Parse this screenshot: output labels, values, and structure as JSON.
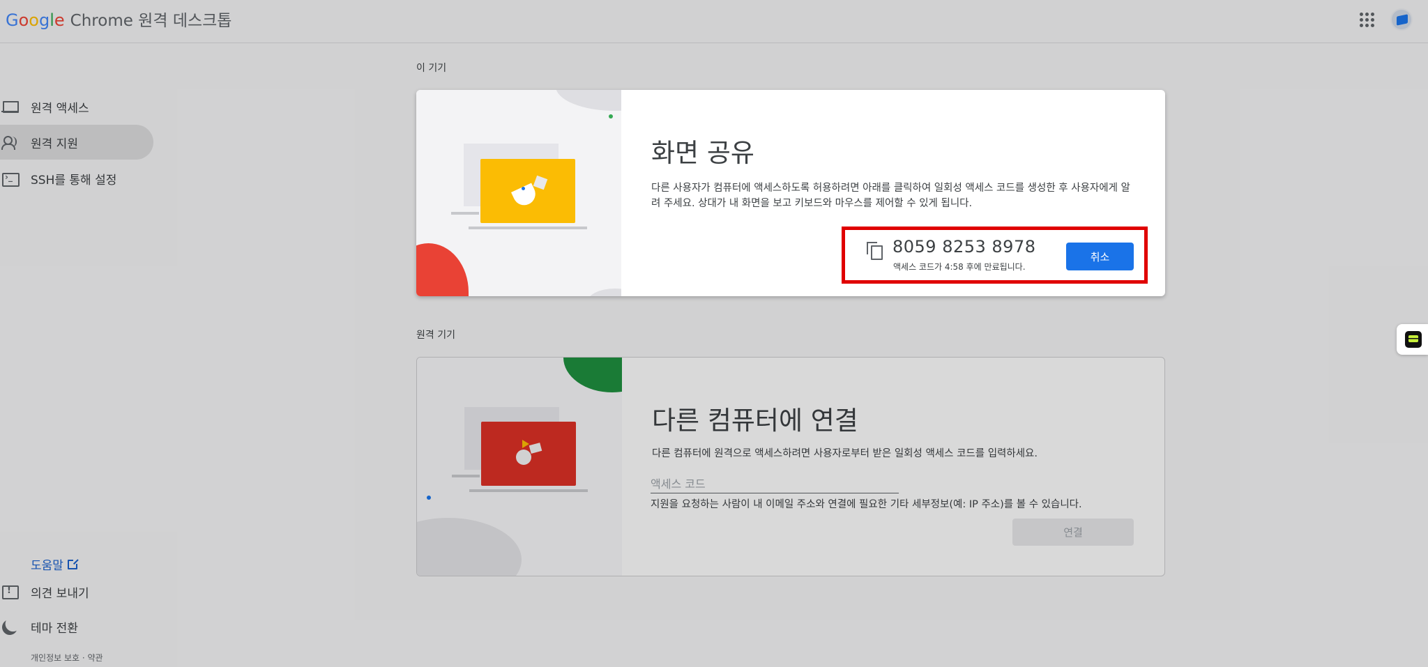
{
  "header": {
    "brand_google": [
      "G",
      "o",
      "o",
      "g",
      "l",
      "e"
    ],
    "brand_rest": "Chrome 원격 데스크톱"
  },
  "sidebar": {
    "items": [
      {
        "label": "원격 액세스",
        "icon": "laptop-icon"
      },
      {
        "label": "원격 지원",
        "icon": "people-icon"
      },
      {
        "label": "SSH를 통해 설정",
        "icon": "terminal-icon"
      }
    ],
    "help_label": "도움말",
    "feedback_label": "의견 보내기",
    "theme_label": "테마 전환",
    "legal": "개인정보 보호 · 약관"
  },
  "this_device": {
    "section_label": "이 기기",
    "title": "화면 공유",
    "description": "다른 사용자가 컴퓨터에 액세스하도록 허용하려면 아래를 클릭하여 일회성 액세스 코드를 생성한 후 사용자에게 알려 주세요. 상대가 내 화면을 보고 키보드와 마우스를 제어할 수 있게 됩니다.",
    "access_code": "8059  8253  8978",
    "expire_text": "액세스 코드가 4:58 후에 만료됩니다.",
    "cancel_label": "취소"
  },
  "remote_device": {
    "section_label": "원격 기기",
    "title": "다른 컴퓨터에 연결",
    "description": "다른 컴퓨터에 원격으로 액세스하려면 사용자로부터 받은 일회성 액세스 코드를 입력하세요.",
    "input_placeholder": "액세스 코드",
    "input_value": "",
    "hint": "지원을 요청하는 사람이 내 이메일 주소와 연결에 필요한 기타 세부정보(예: IP 주소)를 볼 수 있습니다.",
    "connect_label": "연결"
  },
  "colors": {
    "accent": "#1a73e8",
    "highlight": "#e00000",
    "yellow": "#fbbc04",
    "red": "#d93025",
    "green": "#1e8e3e"
  }
}
